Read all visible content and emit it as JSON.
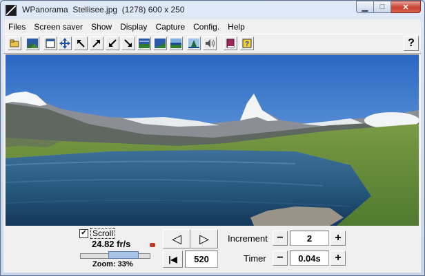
{
  "window": {
    "title": "WPanorama  Stellisee.jpg  (1278) 600 x 250",
    "buttons": {
      "minimize": "▁",
      "maximize": "□",
      "close": "✕"
    }
  },
  "menu": [
    "Files",
    "Screen saver",
    "Show",
    "Display",
    "Capture",
    "Config.",
    "Help"
  ],
  "toolbar": {
    "icons": [
      "open-folder-icon",
      "picture-icon",
      "window-icon",
      "move-arrows-icon",
      "arrow-up-left-icon",
      "arrow-up-right-icon",
      "arrow-down-left-icon",
      "arrow-down-right-icon",
      "landscape-1-icon",
      "landscape-2-icon",
      "landscape-3-icon",
      "landscape-4-icon",
      "speaker-icon",
      "book-icon",
      "help-book-icon"
    ],
    "help_label": "?"
  },
  "controls": {
    "scroll_checked": true,
    "scroll_label": "Scroll",
    "fps": "24.82 fr/s",
    "zoom_label": "Zoom: 33%",
    "zoom_percent": 33,
    "prev_label": "◁",
    "next_label": "▷",
    "first_label": "|◀",
    "position_value": "520",
    "increment_label": "Increment",
    "increment_value": "2",
    "timer_label": "Timer",
    "timer_value": "0.04s",
    "minus_label": "−",
    "plus_label": "+"
  }
}
